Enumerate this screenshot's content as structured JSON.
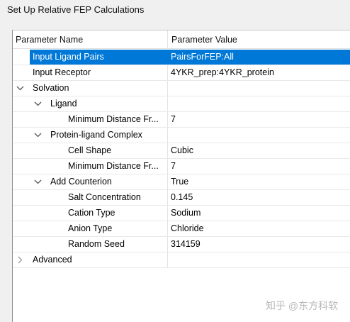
{
  "window": {
    "title": "Set Up Relative FEP Calculations"
  },
  "table": {
    "headers": {
      "name": "Parameter Name",
      "value": "Parameter Value"
    },
    "rows": [
      {
        "name": "Input Ligand Pairs",
        "value": "PairsForFEP:All",
        "level": 0,
        "expander": "none",
        "selected": true
      },
      {
        "name": "Input Receptor",
        "value": "4YKR_prep:4YKR_protein",
        "level": 0,
        "expander": "none"
      },
      {
        "name": "Solvation",
        "value": "",
        "level": 0,
        "expander": "expanded"
      },
      {
        "name": "Ligand",
        "value": "",
        "level": 1,
        "expander": "expanded"
      },
      {
        "name": "Minimum Distance Fr...",
        "value": "7",
        "level": 2,
        "expander": "none"
      },
      {
        "name": "Protein-ligand Complex",
        "value": "",
        "level": 1,
        "expander": "expanded"
      },
      {
        "name": "Cell Shape",
        "value": "Cubic",
        "level": 2,
        "expander": "none"
      },
      {
        "name": "Minimum Distance Fr...",
        "value": "7",
        "level": 2,
        "expander": "none"
      },
      {
        "name": "Add Counterion",
        "value": "True",
        "level": 1,
        "expander": "expanded"
      },
      {
        "name": "Salt Concentration",
        "value": "0.145",
        "level": 2,
        "expander": "none"
      },
      {
        "name": "Cation Type",
        "value": "Sodium",
        "level": 2,
        "expander": "none"
      },
      {
        "name": "Anion Type",
        "value": "Chloride",
        "level": 2,
        "expander": "none"
      },
      {
        "name": "Random Seed",
        "value": "314159",
        "level": 2,
        "expander": "none"
      },
      {
        "name": "Advanced",
        "value": "",
        "level": 0,
        "expander": "collapsed"
      }
    ]
  },
  "watermark": {
    "text": "知乎 @东方科软"
  },
  "colors": {
    "selection": "#0078d7",
    "chevron": "#555555"
  }
}
